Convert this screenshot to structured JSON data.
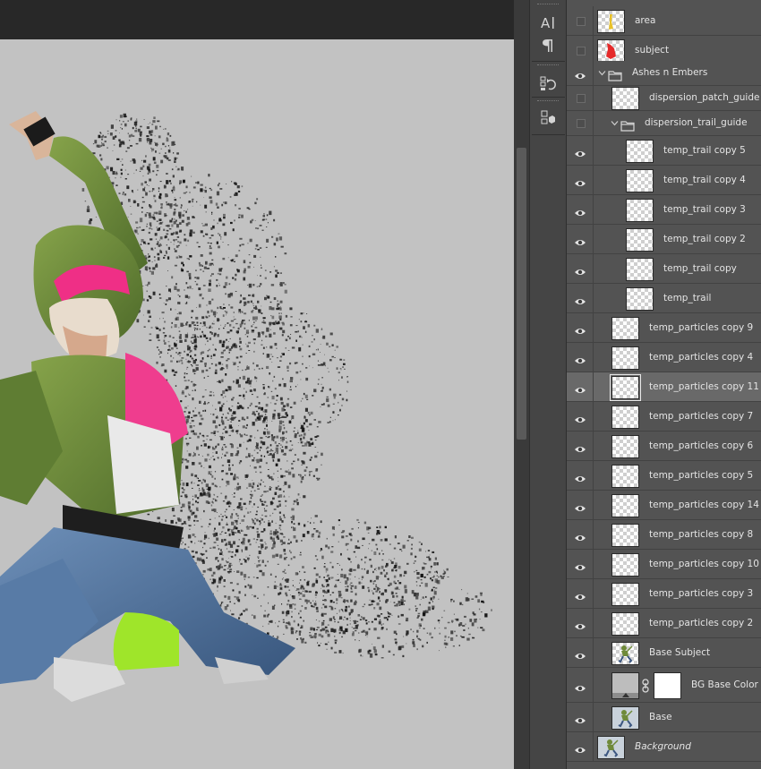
{
  "layers": [
    {
      "name": "area",
      "visible": false,
      "thumb": "checker-figure-yellow",
      "indent": 0
    },
    {
      "name": "subject",
      "visible": false,
      "thumb": "checker-figure-red",
      "indent": 0
    },
    {
      "name": "Ashes n Embers",
      "visible": true,
      "type": "group",
      "indent": 0
    },
    {
      "name": "dispersion_patch_guide",
      "visible": false,
      "thumb": "checker",
      "indent": 1
    },
    {
      "name": "dispersion_trail_guide",
      "visible": false,
      "type": "group",
      "indent": 1
    },
    {
      "name": "temp_trail copy 5",
      "visible": true,
      "thumb": "checker",
      "indent": 2
    },
    {
      "name": "temp_trail copy 4",
      "visible": true,
      "thumb": "checker",
      "indent": 2
    },
    {
      "name": "temp_trail copy 3",
      "visible": true,
      "thumb": "checker",
      "indent": 2
    },
    {
      "name": "temp_trail copy 2",
      "visible": true,
      "thumb": "checker",
      "indent": 2
    },
    {
      "name": "temp_trail copy",
      "visible": true,
      "thumb": "checker",
      "indent": 2
    },
    {
      "name": "temp_trail",
      "visible": true,
      "thumb": "checker",
      "indent": 2
    },
    {
      "name": "temp_particles copy 9",
      "visible": true,
      "thumb": "checker",
      "indent": 1
    },
    {
      "name": "temp_particles copy 4",
      "visible": true,
      "thumb": "checker",
      "indent": 1
    },
    {
      "name": "temp_particles copy 11",
      "visible": true,
      "thumb": "checker",
      "indent": 1,
      "selected": true
    },
    {
      "name": "temp_particles copy 7",
      "visible": true,
      "thumb": "checker",
      "indent": 1
    },
    {
      "name": "temp_particles copy 6",
      "visible": true,
      "thumb": "checker",
      "indent": 1
    },
    {
      "name": "temp_particles copy 5",
      "visible": true,
      "thumb": "checker",
      "indent": 1
    },
    {
      "name": "temp_particles copy 14",
      "visible": true,
      "thumb": "checker",
      "indent": 1
    },
    {
      "name": "temp_particles copy 8",
      "visible": true,
      "thumb": "checker",
      "indent": 1
    },
    {
      "name": "temp_particles copy 10",
      "visible": true,
      "thumb": "checker",
      "indent": 1
    },
    {
      "name": "temp_particles copy 3",
      "visible": true,
      "thumb": "checker",
      "indent": 1
    },
    {
      "name": "temp_particles copy 2",
      "visible": true,
      "thumb": "checker",
      "indent": 1
    },
    {
      "name": "Base Subject",
      "visible": true,
      "thumb": "figure",
      "indent": 1
    },
    {
      "name": "BG Base Color",
      "visible": true,
      "thumb": "gray-with-mask",
      "indent": 1
    },
    {
      "name": "Base",
      "visible": true,
      "thumb": "figure-bg",
      "indent": 1
    },
    {
      "name": "Background",
      "visible": true,
      "thumb": "figure-bg",
      "indent": 0,
      "italic": true
    }
  ],
  "tools": [
    {
      "icon": "character-icon",
      "glyph": "A|"
    },
    {
      "icon": "paragraph-icon",
      "glyph": "¶"
    },
    {
      "icon": "history-icon",
      "glyph": "⟲"
    },
    {
      "icon": "3d-cube-icon",
      "glyph": "▦"
    }
  ],
  "colors": {
    "canvas_bg": "#c2c2c2",
    "panel_bg": "#535353",
    "selected_row": "#696969",
    "hoodie": "#6f8a3a",
    "hat": "#ef2f86",
    "jeans": "#4d6f97",
    "legwarmer": "#9fe52a"
  }
}
